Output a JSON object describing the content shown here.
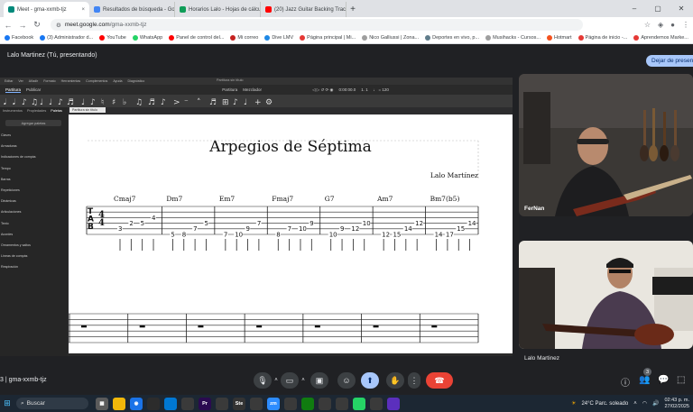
{
  "browser": {
    "tabs": [
      {
        "label": "Meet - gma-xxmb-tjz",
        "color": "#00897b",
        "active": true
      },
      {
        "label": "Resultados de búsqueda - Goo",
        "color": "#4285f4",
        "active": false
      },
      {
        "label": "Horarios Lalo - Hojas de cálcul",
        "color": "#0f9d58",
        "active": false
      },
      {
        "label": "(20) Jazz Guitar Backing Track 2",
        "color": "#ff0000",
        "active": false
      }
    ],
    "tab_close": "×",
    "new_tab": "+",
    "window_controls": [
      "–",
      "▢",
      "✕"
    ],
    "address_host": "meet.google.com",
    "address_path": "/gma-xxmb-tjz",
    "bookmarks": [
      {
        "label": "Facebook",
        "color": "#1877f2"
      },
      {
        "label": "(3) Administrador d...",
        "color": "#1877f2"
      },
      {
        "label": "YouTube",
        "color": "#ff0000"
      },
      {
        "label": "WhatsApp",
        "color": "#25d366"
      },
      {
        "label": "Panel de control del...",
        "color": "#ff0000"
      },
      {
        "label": "Mi correo",
        "color": "#c5221f"
      },
      {
        "label": "Dive LMV",
        "color": "#1e88e5"
      },
      {
        "label": "Página principal | Mi...",
        "color": "#e53935"
      },
      {
        "label": "Nico Galliussi | Zona...",
        "color": "#9e9e9e"
      },
      {
        "label": "Deportes en vivo, p...",
        "color": "#607d8b"
      },
      {
        "label": "Musihacks - Cursos...",
        "color": "#9e9e9e"
      },
      {
        "label": "Hotmart",
        "color": "#f4511e"
      },
      {
        "label": "Página de inicio -...",
        "color": "#e53935"
      },
      {
        "label": "Aprendemos Marke...",
        "color": "#e53935"
      }
    ]
  },
  "meet": {
    "presenter": "Lalo Martinez (Tú, presentando)",
    "stop_presenting": "Dejar de present",
    "participants": [
      {
        "name": "FerNan"
      }
    ],
    "self_name": "Lalo Martinez",
    "meeting_code": "3 | gma-xxmb-tjz",
    "participant_count": "3"
  },
  "musescore": {
    "menu": [
      "Editar",
      "Ver",
      "Añadir",
      "Formato",
      "Herramientas",
      "Complementos",
      "Ayuda",
      "Diagnóstico"
    ],
    "window_title": "Partitura sin título",
    "tabs": [
      "Partitura",
      "Publicar"
    ],
    "mode_buttons": [
      "Partitura",
      "Mezclador"
    ],
    "zoom_readout": "0:00:00.0",
    "position_readout": "1. 1",
    "tempo": "♩ = 120",
    "left_tabs": [
      "Instrumentos",
      "Propiedades",
      "Paletas"
    ],
    "palette_search": "Agregar paletas",
    "palette_items": [
      "Claves",
      "Armaduras",
      "Indicaciones de compás",
      "Tempo",
      "Barras",
      "Repeticiones",
      "Dinámicas",
      "Articulaciones",
      "Texto",
      "Acordes",
      "Ornamentos y saltos",
      "Líneas de compás",
      "Respiración"
    ],
    "doc_tab": "Partitura sin título",
    "status": [
      "Espacio de trabajo: Default",
      "Afinación de concierto",
      "Vista de páginas ▾",
      "25% ▾"
    ],
    "score": {
      "title": "Arpegios de Séptima",
      "composer": "Lalo Martínez",
      "chords": [
        "Cmaj7",
        "Dm7",
        "Em7",
        "Fmaj7",
        "G7",
        "Am7",
        "Bm7(b5)"
      ],
      "tab_clef": [
        "T",
        "A",
        "B"
      ],
      "time_signature": [
        "4",
        "4"
      ],
      "tab_numbers": [
        {
          "s": 5,
          "t": "3"
        },
        {
          "s": 4,
          "t": "2"
        },
        {
          "s": 4,
          "t": "5"
        },
        {
          "s": 3,
          "t": "4"
        },
        {
          "s": 6,
          "t": "5"
        },
        {
          "s": 6,
          "t": "8"
        },
        {
          "s": 5,
          "t": "7"
        },
        {
          "s": 4,
          "t": "5"
        },
        {
          "s": 6,
          "t": "7"
        },
        {
          "s": 6,
          "t": "10"
        },
        {
          "s": 5,
          "t": "9"
        },
        {
          "s": 4,
          "t": "7"
        },
        {
          "s": 6,
          "t": "8"
        },
        {
          "s": 5,
          "t": "7"
        },
        {
          "s": 5,
          "t": "10"
        },
        {
          "s": 4,
          "t": "9"
        },
        {
          "s": 6,
          "t": "10"
        },
        {
          "s": 5,
          "t": "9"
        },
        {
          "s": 5,
          "t": "12"
        },
        {
          "s": 4,
          "t": "10"
        },
        {
          "s": 6,
          "t": "12"
        },
        {
          "s": 6,
          "t": "15"
        },
        {
          "s": 5,
          "t": "14"
        },
        {
          "s": 4,
          "t": "12"
        },
        {
          "s": 6,
          "t": "14"
        },
        {
          "s": 6,
          "t": "17"
        },
        {
          "s": 5,
          "t": "15"
        },
        {
          "s": 4,
          "t": "14"
        }
      ]
    }
  },
  "taskbar": {
    "search": "Buscar",
    "weather": "24°C  Parc. soleado",
    "time": "02:43 p. m.",
    "date": "27/02/2025",
    "apps": [
      {
        "label": "▦",
        "color": "#5b5b5b"
      },
      {
        "label": "",
        "color": "#f2b80a"
      },
      {
        "label": "◉",
        "color": "#1a73e8"
      },
      {
        "label": "",
        "color": "#2c2c2c"
      },
      {
        "label": "",
        "color": "#0078d4"
      },
      {
        "label": "",
        "color": "#3a3a3a"
      },
      {
        "label": "Pr",
        "color": "#2a0a50"
      },
      {
        "label": "",
        "color": "#3a3a3a"
      },
      {
        "label": "Ste",
        "color": "#333"
      },
      {
        "label": "",
        "color": "#3a3a3a"
      },
      {
        "label": "zm",
        "color": "#2d8cff"
      },
      {
        "label": "",
        "color": "#3a3a3a"
      },
      {
        "label": "",
        "color": "#107c10"
      },
      {
        "label": "",
        "color": "#3a3a3a"
      },
      {
        "label": "",
        "color": "#3a3a3a"
      },
      {
        "label": "",
        "color": "#25d366"
      },
      {
        "label": "",
        "color": "#3a3a3a"
      },
      {
        "label": "",
        "color": "#5b2fbd"
      }
    ]
  }
}
